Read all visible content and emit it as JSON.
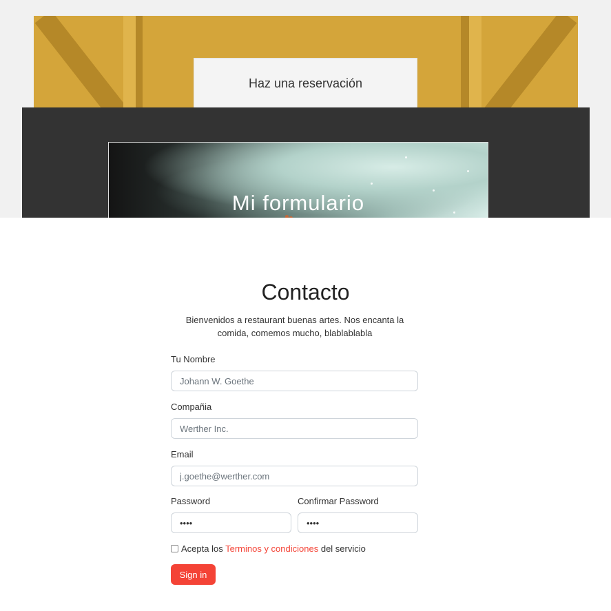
{
  "reservation": {
    "button_label": "Haz una reservación"
  },
  "hero": {
    "title": "Mi formulario"
  },
  "contact": {
    "title": "Contacto",
    "description": "Bienvenidos a restaurant buenas artes. Nos encanta la comida, comemos mucho, blablablabla",
    "fields": {
      "name": {
        "label": "Tu Nombre",
        "placeholder": "Johann W. Goethe"
      },
      "company": {
        "label": "Compañia",
        "placeholder": "Werther Inc."
      },
      "email": {
        "label": "Email",
        "placeholder": "j.goethe@werther.com"
      },
      "password": {
        "label": "Password",
        "value": "1234"
      },
      "confirm_password": {
        "label": "Confirmar Password",
        "value": "1234"
      }
    },
    "terms": {
      "prefix": "Acepta los",
      "link": "Terminos y condiciones",
      "suffix": "del servicio"
    },
    "submit_label": "Sign in"
  },
  "colors": {
    "accent": "#f44336",
    "reservation_bg": "#d4a53a",
    "hero_frame_bg": "#333333"
  }
}
